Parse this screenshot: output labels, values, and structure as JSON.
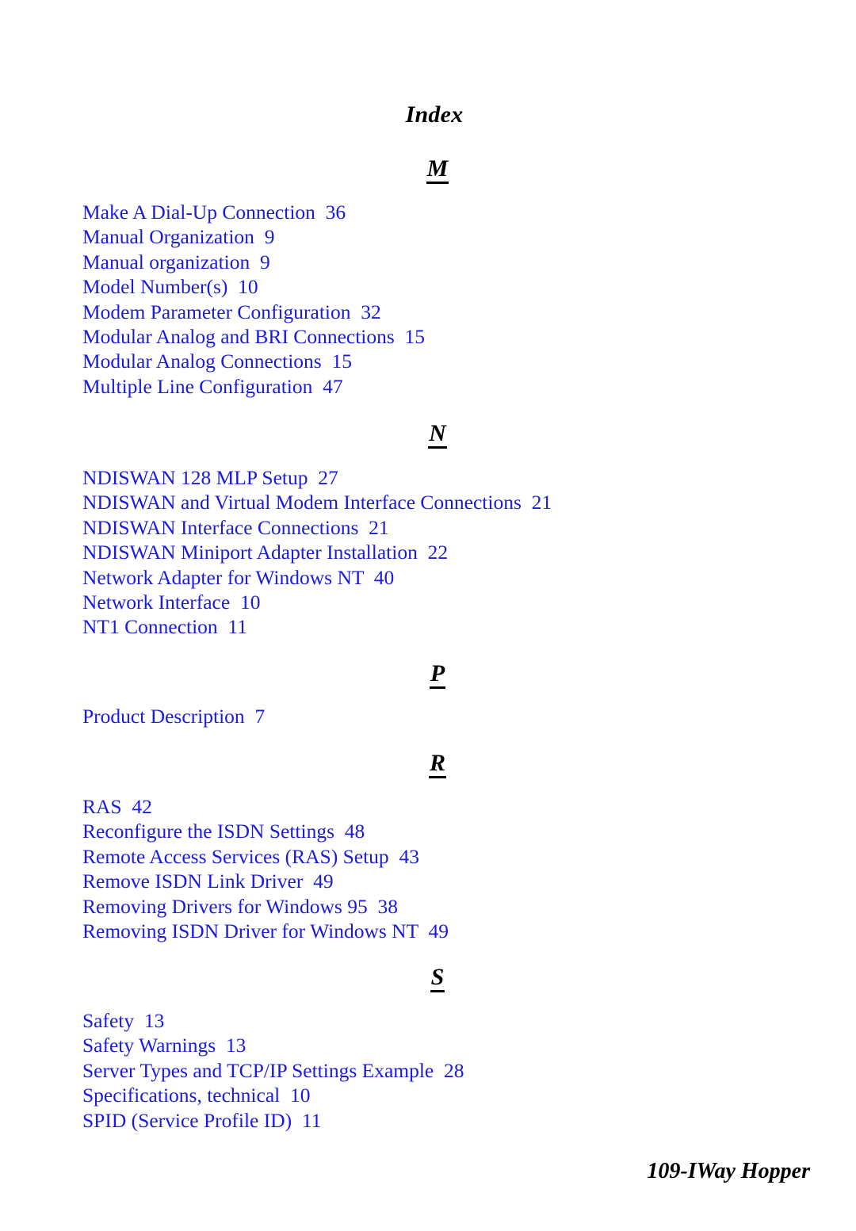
{
  "page": {
    "title": "Index",
    "footer": "109-IWay Hopper"
  },
  "sections": [
    {
      "letter": "M",
      "entries": [
        {
          "title": "Make A Dial-Up Connection",
          "page": "36"
        },
        {
          "title": "Manual Organization",
          "page": "9"
        },
        {
          "title": "Manual organization",
          "page": "9"
        },
        {
          "title": "Model Number(s)",
          "page": "10"
        },
        {
          "title": "Modem Parameter Configuration",
          "page": "32"
        },
        {
          "title": "Modular Analog and BRI Connections",
          "page": "15"
        },
        {
          "title": "Modular Analog Connections",
          "page": "15"
        },
        {
          "title": "Multiple Line Configuration",
          "page": "47"
        }
      ]
    },
    {
      "letter": "N",
      "entries": [
        {
          "title": "NDISWAN 128 MLP Setup",
          "page": "27"
        },
        {
          "title": "NDISWAN and Virtual Modem Interface Connections",
          "page": "21"
        },
        {
          "title": "NDISWAN Interface Connections",
          "page": "21"
        },
        {
          "title": "NDISWAN Miniport Adapter Installation",
          "page": "22"
        },
        {
          "title": "Network Adapter for Windows NT",
          "page": "40"
        },
        {
          "title": "Network Interface",
          "page": "10"
        },
        {
          "title": "NT1 Connection",
          "page": "11"
        }
      ]
    },
    {
      "letter": "P",
      "entries": [
        {
          "title": "Product Description",
          "page": "7"
        }
      ]
    },
    {
      "letter": "R",
      "entries": [
        {
          "title": "RAS",
          "page": "42"
        },
        {
          "title": "Reconfigure the ISDN Settings",
          "page": "48"
        },
        {
          "title": "Remote Access Services (RAS) Setup",
          "page": "43"
        },
        {
          "title": "Remove ISDN Link Driver",
          "page": "49"
        },
        {
          "title": "Removing Drivers for Windows 95",
          "page": "38"
        },
        {
          "title": "Removing ISDN Driver for Windows NT",
          "page": "49"
        }
      ]
    },
    {
      "letter": "S",
      "entries": [
        {
          "title": "Safety",
          "page": "13"
        },
        {
          "title": "Safety Warnings",
          "page": "13"
        },
        {
          "title": "Server Types and TCP/IP Settings Example",
          "page": "28"
        },
        {
          "title": "Specifications, technical",
          "page": "10"
        },
        {
          "title": "SPID (Service Profile ID)",
          "page": "11"
        }
      ]
    }
  ],
  "layout": {
    "letter_tops": [
      196,
      530,
      833,
      946,
      1216
    ],
    "entry_tops": [
      252,
      587,
      888,
      1002,
      1272
    ]
  },
  "colors": {
    "entry_text": "#1a1ae0",
    "heading_text": "#000000",
    "background": "#ffffff"
  }
}
